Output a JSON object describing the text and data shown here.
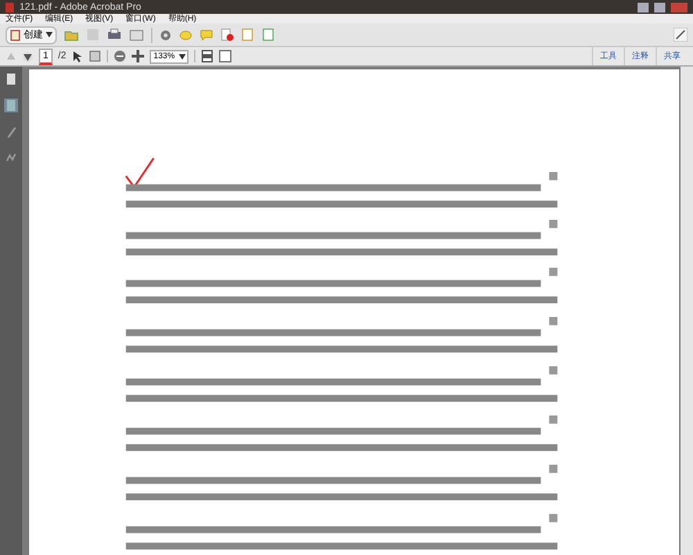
{
  "window": {
    "title": "121.pdf - Adobe Acrobat Pro"
  },
  "menu": [
    "文件(F)",
    "编辑(E)",
    "视图(V)",
    "窗口(W)",
    "帮助(H)"
  ],
  "toolbar": {
    "create_label": "创建"
  },
  "navigation": {
    "page": "1",
    "total": "/2",
    "zoom": "133%"
  },
  "panes": [
    {
      "label": "工具",
      "selected": false
    },
    {
      "label": "注释",
      "selected": false
    },
    {
      "label": "共享",
      "selected": false
    }
  ],
  "sidebar": [
    {
      "kind": "pages",
      "selected": false
    },
    {
      "kind": "bookmarks",
      "selected": true
    },
    {
      "kind": "attachments",
      "selected": false
    },
    {
      "kind": "signatures",
      "selected": false
    }
  ]
}
